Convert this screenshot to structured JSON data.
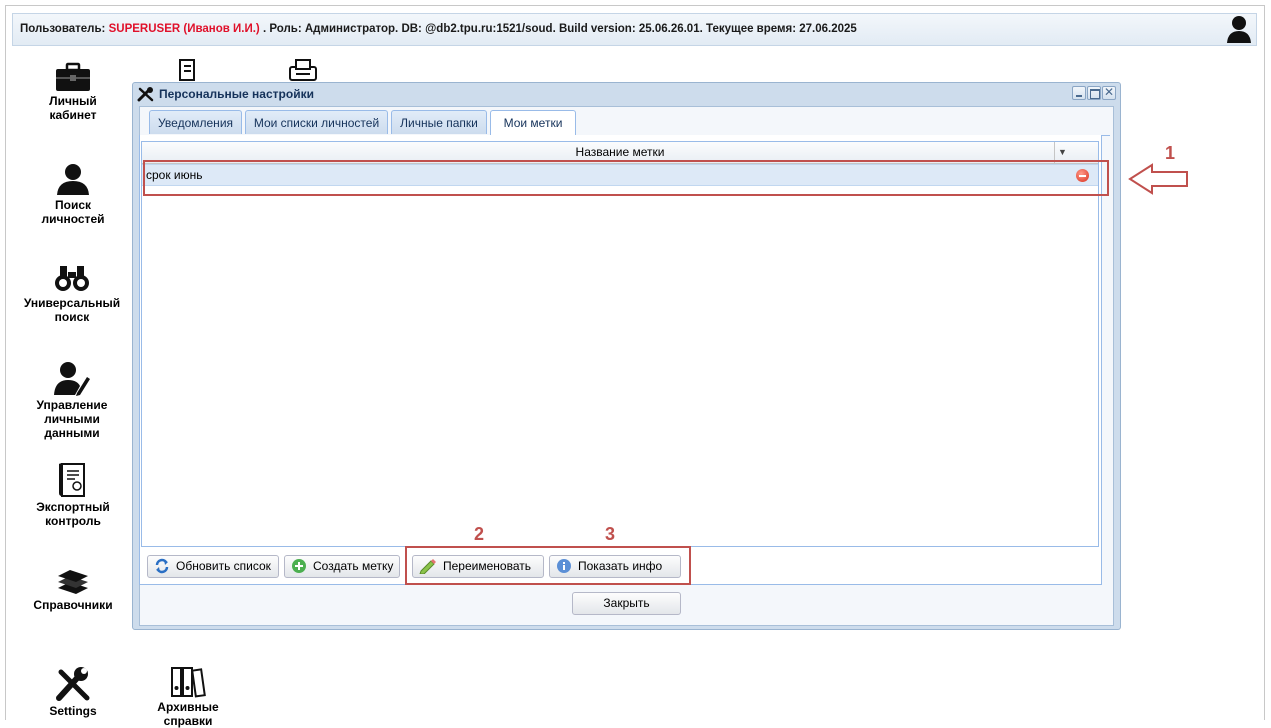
{
  "header": {
    "user_label": "Пользователь:",
    "user_name": "SUPERUSER (Иванов И.И.)",
    "info": ". Роль: Администратор. DB: @db2.tpu.ru:1521/soud. Build version: 25.06.26.01. Текущее время: 27.06.2025"
  },
  "desktop": {
    "items": [
      {
        "label": "Личный кабинет",
        "icon": "briefcase-icon"
      },
      {
        "label": "Поиск личностей",
        "icon": "person-icon"
      },
      {
        "label": "Универсальный поиск",
        "icon": "binoculars-icon"
      },
      {
        "label": "Управление личными данными",
        "icon": "user-edit-icon"
      },
      {
        "label": "Экспортный контроль",
        "icon": "certificate-icon"
      },
      {
        "label": "Справочники",
        "icon": "books-icon"
      },
      {
        "label": "Settings",
        "icon": "tools-icon"
      },
      {
        "label": "Архивные справки",
        "icon": "binders-icon"
      }
    ]
  },
  "dialog": {
    "title": "Персональные настройки",
    "tabs": [
      "Уведомления",
      "Мои списки личностей",
      "Личные папки",
      "Мои метки"
    ],
    "active_tab": "Мои метки",
    "grid": {
      "column": "Название метки",
      "rows": [
        "срок июнь"
      ]
    },
    "buttons": {
      "refresh": "Обновить список",
      "create": "Создать метку",
      "rename": "Переименовать",
      "info": "Показать инфо",
      "close": "Закрыть"
    }
  },
  "annotations": [
    "1",
    "2",
    "3"
  ],
  "colors": {
    "accent_red": "#c0504d",
    "user_red": "#e0102a",
    "window_blue": "#cddcec"
  }
}
